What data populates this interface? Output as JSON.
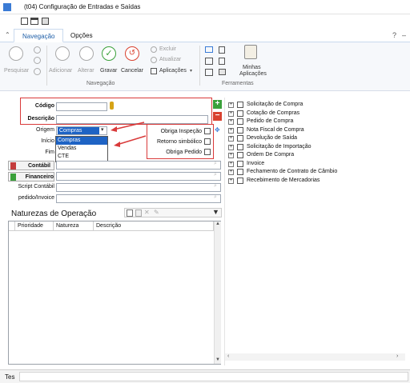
{
  "window": {
    "title": "(t04)  Configuração de Entradas e Saídas"
  },
  "tabs": [
    {
      "label": "Navegação"
    },
    {
      "label": "Opções"
    }
  ],
  "window_controls": {
    "help": "?",
    "minimize": "–"
  },
  "ribbon": {
    "pesquisar": "Pesquisar",
    "adicionar": "Adicionar",
    "alterar": "Alterar",
    "gravar": "Gravar",
    "cancelar": "Cancelar",
    "excluir": "Excluir",
    "atualizar": "Atualizar",
    "aplicacoes": "Aplicações",
    "minhas": "Minhas",
    "minhas_aplicacoes": "Aplicações",
    "group_navegacao": "Navegação",
    "group_ferramentas": "Ferramentas"
  },
  "form": {
    "codigo_label": "Código",
    "descricao_label": "Descrição",
    "origem_label": "Origem",
    "origem_value": "Compras",
    "origem_options": [
      "Compras",
      "Vendas",
      "CTE"
    ],
    "inicio_label": "Início",
    "fim_label": "Fim",
    "contabil_label": "Contábil",
    "financeiro_label": "Financeiro",
    "script_label": "Script Contábil",
    "pedido_label": "pedido/Invoice",
    "obriga_inspecao": "Obriga Inspeção",
    "retorno_simbolico": "Retorno simbólico",
    "obriga_pedido": "Obriga Pedido"
  },
  "naturezas": {
    "title": "Naturezas de Operação",
    "columns": [
      "Prioridade",
      "Natureza",
      "Descrição"
    ]
  },
  "tree": [
    "Solicitação de Compra",
    "Cotação de Compras",
    "Pedido de Compra",
    "Nota Fiscal de Compra",
    "Devolução de Saída",
    "Solicitação de Importação",
    "Ordem De Compra",
    "Invoice",
    "Fechamento de Contrato de Câmbio",
    "Recebimento de Mercadorias"
  ],
  "status": {
    "text": "Tes"
  },
  "colors": {
    "accent": "#1f5fa8",
    "highlight_red": "#d93a3a",
    "add_green": "#3aa03a",
    "remove_red": "#d9412f"
  }
}
